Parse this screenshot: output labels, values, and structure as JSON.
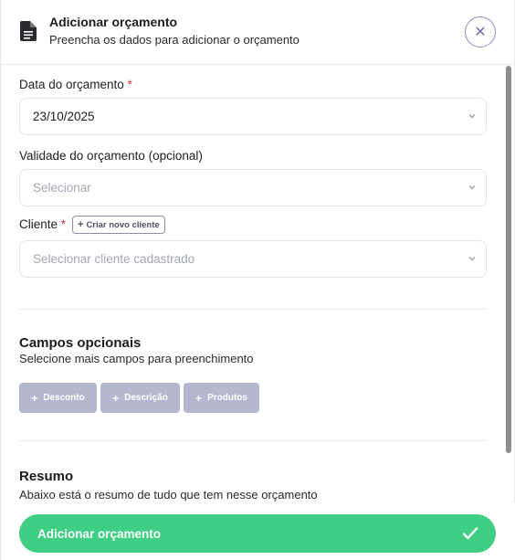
{
  "header": {
    "title": "Adicionar orçamento",
    "subtitle": "Preencha os dados para adicionar o orçamento",
    "close_symbol": "✕"
  },
  "form": {
    "date": {
      "label": "Data do orçamento",
      "required_mark": "*",
      "value": "23/10/2025"
    },
    "validity": {
      "label": "Validade do orçamento (opcional)",
      "placeholder": "Selecionar"
    },
    "client": {
      "label": "Cliente",
      "required_mark": "*",
      "create_label": "Criar novo cliente",
      "placeholder": "Selecionar cliente cadastrado"
    }
  },
  "optional_fields": {
    "title": "Campos opcionais",
    "subtitle": "Selecione mais campos para preenchimento",
    "buttons": [
      {
        "label": "Desconto"
      },
      {
        "label": "Descrição"
      },
      {
        "label": "Produtos"
      }
    ]
  },
  "summary": {
    "title": "Resumo",
    "subtitle": "Abaixo está o resumo de tudo que tem nesse orçamento"
  },
  "footer": {
    "submit_label": "Adicionar orçamento"
  },
  "colors": {
    "accent_green": "#3ecf85",
    "optional_button": "#b4b7cf",
    "required": "#e0294a"
  }
}
